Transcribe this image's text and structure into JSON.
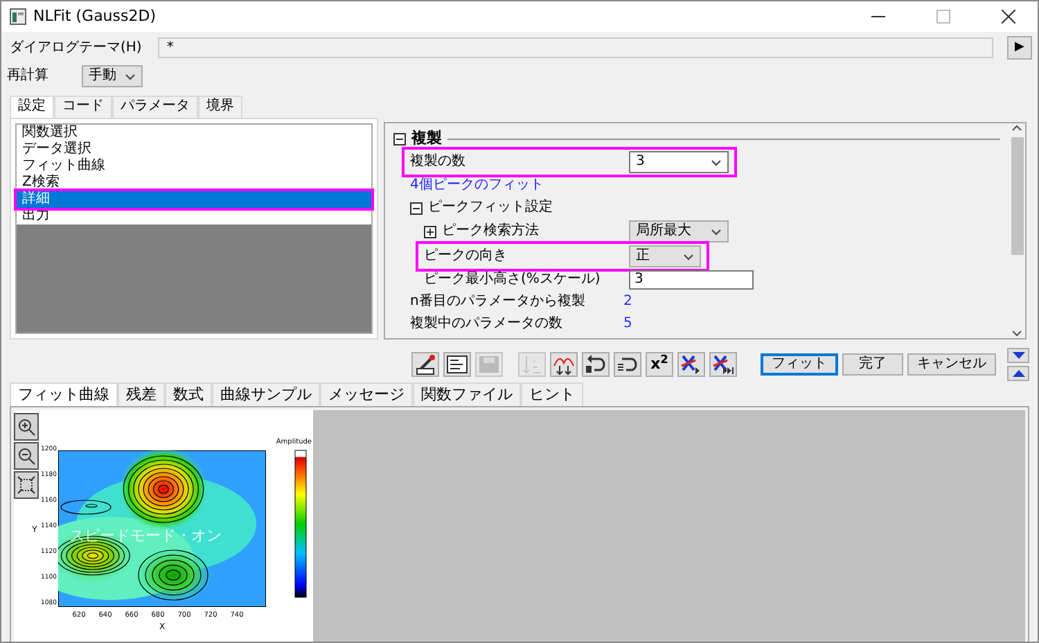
{
  "window": {
    "title": "NLFit (Gauss2D)"
  },
  "theme": {
    "label": "ダイアログテーマ(H)",
    "value": "*",
    "button": "▶"
  },
  "recalc": {
    "label": "再計算",
    "value": "手動"
  },
  "top_tabs": [
    {
      "label": "設定",
      "selected": true
    },
    {
      "label": "コード",
      "selected": false
    },
    {
      "label": "パラメータ",
      "selected": false
    },
    {
      "label": "境界",
      "selected": false
    }
  ],
  "left_list": [
    {
      "label": "関数選択",
      "selected": false,
      "highlighted": false
    },
    {
      "label": "データ選択",
      "selected": false,
      "highlighted": false
    },
    {
      "label": "フィット曲線",
      "selected": false,
      "highlighted": false
    },
    {
      "label": "Z検索",
      "selected": false,
      "highlighted": false
    },
    {
      "label": "詳細",
      "selected": true,
      "highlighted": true
    },
    {
      "label": "出力",
      "selected": false,
      "highlighted": false
    }
  ],
  "properties": {
    "kind": "group",
    "label": "複製",
    "expanded": true,
    "children": [
      {
        "kind": "dropdown",
        "label": "複製の数",
        "value": "3",
        "highlighted": true
      },
      {
        "kind": "link",
        "label": "4個ピークのフィット"
      },
      {
        "kind": "group",
        "label": "ピークフィット設定",
        "expanded": true,
        "children": [
          {
            "kind": "dropdown",
            "label": "ピーク検索方法",
            "value": "局所最大",
            "expanded": false,
            "highlighted": false
          },
          {
            "kind": "dropdown",
            "label": "ピークの向き",
            "value": "正",
            "highlighted": true
          },
          {
            "kind": "input",
            "label": "ピーク最小高さ(%スケール)",
            "value": "3",
            "highlighted": false
          }
        ]
      },
      {
        "kind": "value",
        "label": "n番目のパラメータから複製",
        "value": "2"
      },
      {
        "kind": "value",
        "label": "複製中のパラメータの数",
        "value": "5"
      }
    ]
  },
  "toolbar": [
    [
      {
        "kind": "icon",
        "disabled": false
      },
      {
        "kind": "icon",
        "disabled": false
      },
      {
        "kind": "icon",
        "disabled": true
      }
    ],
    [
      {
        "kind": "icon",
        "disabled": true
      },
      {
        "kind": "icon",
        "disabled": false
      }
    ],
    [
      {
        "kind": "icon",
        "disabled": false
      },
      {
        "kind": "icon",
        "disabled": false
      },
      {
        "kind": "text",
        "label": "x$^{2}$",
        "disabled": false
      },
      {
        "kind": "icon",
        "disabled": false
      },
      {
        "kind": "icon",
        "disabled": false
      }
    ]
  ],
  "buttons": [
    {
      "label": "フィット",
      "default": true
    },
    {
      "label": "完了",
      "default": false
    },
    {
      "label": "キャンセル",
      "default": false
    }
  ],
  "bottom_tabs": [
    {
      "label": "フィット曲線",
      "selected": true
    },
    {
      "label": "残差",
      "selected": false
    },
    {
      "label": "数式",
      "selected": false
    },
    {
      "label": "曲線サンプル",
      "selected": false
    },
    {
      "label": "メッセージ",
      "selected": false
    },
    {
      "label": "関数ファイル",
      "selected": false
    },
    {
      "label": "ヒント",
      "selected": false
    }
  ],
  "plot": {
    "overlay_text": "スピードモード・オン",
    "xlabel": "X",
    "ylabel": "Y",
    "colorbar_title": "Amplitude",
    "x_ticks": [
      "620",
      "640",
      "660",
      "680",
      "700",
      "720",
      "740"
    ],
    "y_ticks": [
      "1200",
      "1180",
      "1160",
      "1140",
      "1120",
      "1100",
      "1080"
    ]
  }
}
